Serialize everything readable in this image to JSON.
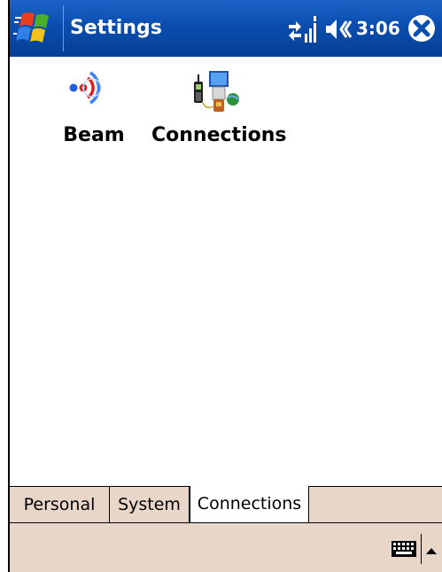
{
  "titlebar": {
    "title": "Settings",
    "time": "3:06"
  },
  "apps": [
    {
      "label": "Beam",
      "icon": "beam-icon"
    },
    {
      "label": "Connections",
      "icon": "connections-icon"
    }
  ],
  "tabs": [
    {
      "label": "Personal",
      "selected": false
    },
    {
      "label": "System",
      "selected": false
    },
    {
      "label": "Connections",
      "selected": true
    }
  ],
  "colors": {
    "titlebar": "#0b4fb1",
    "menubar": "#e8d6c9"
  }
}
